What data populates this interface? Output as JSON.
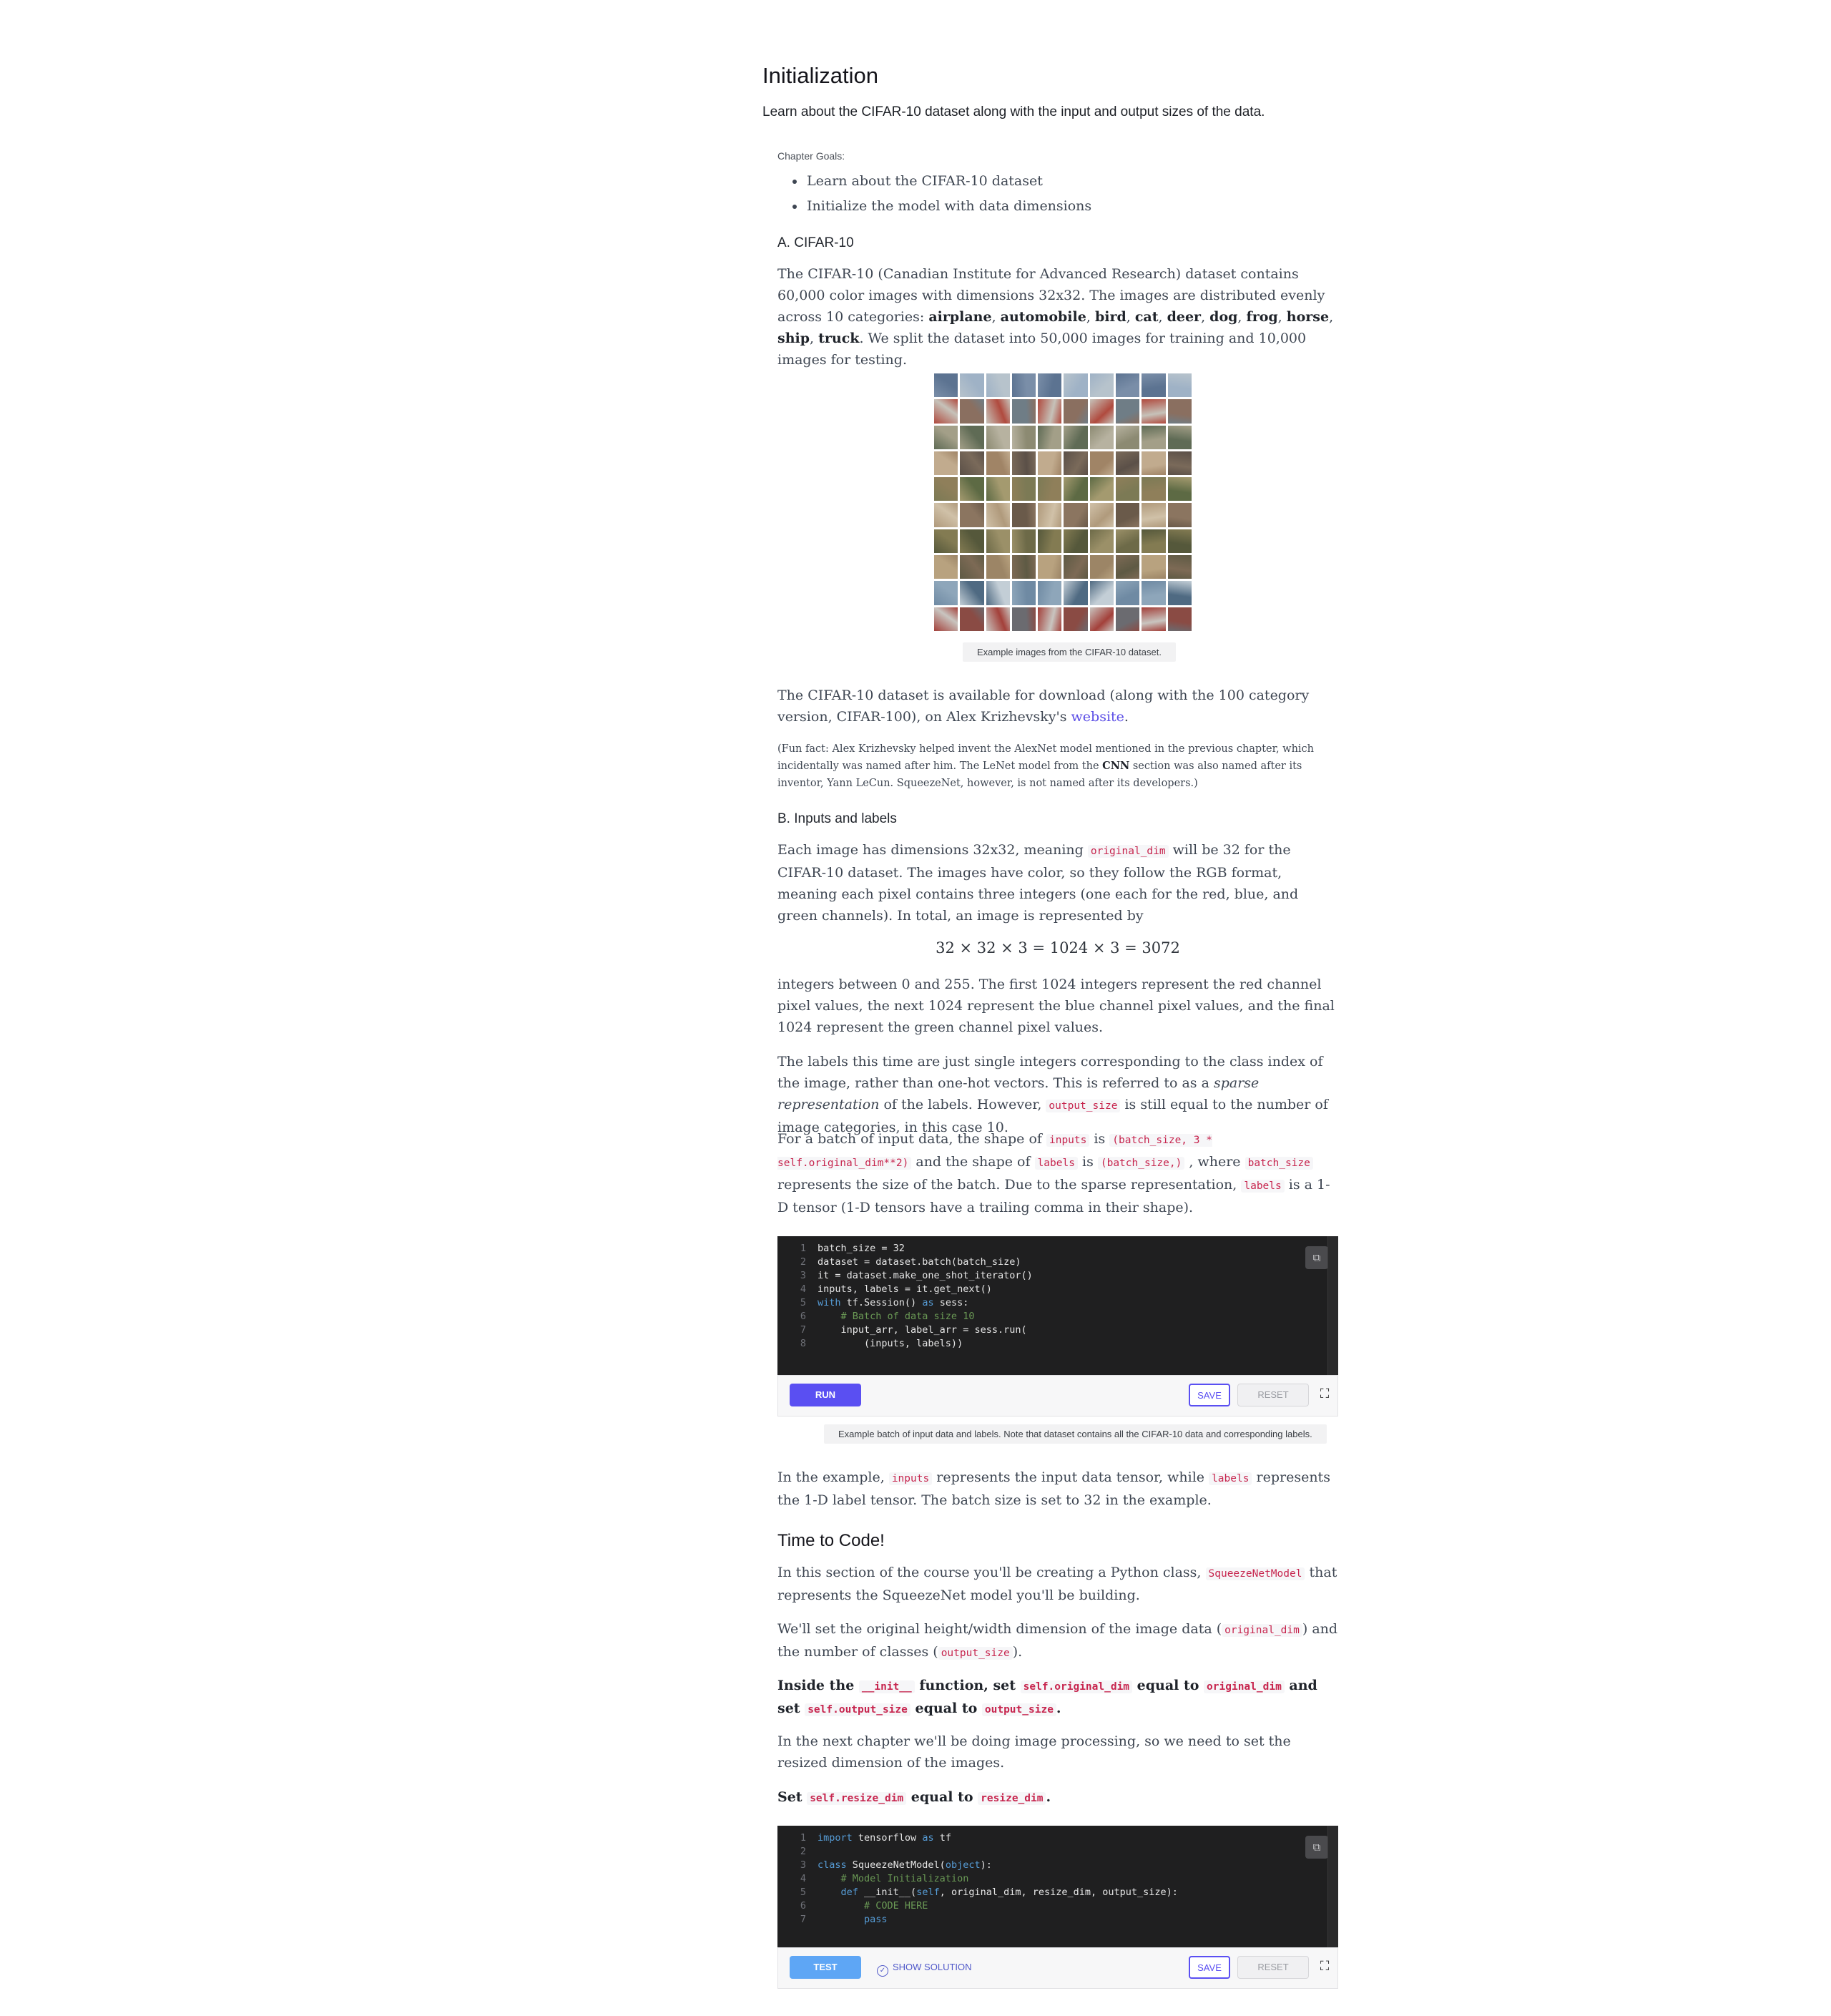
{
  "header": {
    "title": "Initialization",
    "lede": "Learn about the CIFAR-10 dataset along with the input and output sizes of the data."
  },
  "goals": {
    "label": "Chapter Goals:",
    "items": [
      "Learn about the CIFAR-10 dataset",
      "Initialize the model with data dimensions"
    ]
  },
  "sectionA": {
    "heading": "A. CIFAR-10",
    "p1_a": "The CIFAR-10 (Canadian Institute for Advanced Research) dataset contains 60,000 color images with dimensions 32x32. The images are distributed evenly across 10 categories:",
    "categories": [
      "airplane",
      "automobile",
      "bird",
      "cat",
      "deer",
      "dog",
      "frog",
      "horse",
      "ship",
      "truck"
    ],
    "p1_b": ". We split the dataset into 50,000 images for training and 10,000 images for testing.",
    "image_caption": "Example images from the CIFAR-10 dataset.",
    "p2_a": "The CIFAR-10 dataset is available for download (along with the 100 category version, CIFAR-100), on Alex Krizhevsky's ",
    "p2_link": "website",
    "p2_b": ".",
    "fun_a": "(Fun fact: Alex Krizhevsky helped invent the AlexNet model mentioned in the previous chapter, which incidentally was named after him. The LeNet model from the ",
    "fun_bold": "CNN",
    "fun_b": " section was also named after its inventor, Yann LeCun. SqueezeNet, however, is not named after its developers.)"
  },
  "sectionB": {
    "heading": "B. Inputs and labels",
    "p1_a": "Each image has dimensions 32x32, meaning ",
    "p1_code": "original_dim",
    "p1_b": " will be 32 for the CIFAR-10 dataset. The images have color, so they follow the RGB format, meaning each pixel contains three integers (one each for the red, blue, and green channels). In total, an image is represented by",
    "math": "32 × 32 × 3 = 1024 × 3 = 3072",
    "p2": "integers between 0 and 255. The first 1024 integers represent the red channel pixel values, the next 1024 represent the blue channel pixel values, and the final 1024 represent the green channel pixel values.",
    "p3_a": "The labels this time are just single integers corresponding to the class index of the image, rather than one-hot vectors. This is referred to as a ",
    "p3_em": "sparse representation",
    "p3_b": " of the labels. However, ",
    "p3_code": "output_size",
    "p3_c": " is still equal to the number of image categories, in this case 10.",
    "p4_a": "For a batch of input data, the shape of ",
    "p4_code1": "inputs",
    "p4_b": " is ",
    "p4_code2": "(batch_size, 3 * self.original_dim**2)",
    "p4_c": " and the shape of ",
    "p4_code3": "labels",
    "p4_d": " is ",
    "p4_code4": "(batch_size,)",
    "p4_e": " , where ",
    "p4_code5": "batch_size",
    "p4_f": " represents the size of the batch. Due to the sparse representation, ",
    "p4_code6": "labels",
    "p4_g": " is a 1-D tensor (1-D tensors have a trailing comma in their shape).",
    "code1_caption": "Example batch of input data and labels. Note that dataset contains all the CIFAR-10 data and corresponding labels.",
    "p5_a": "In the example, ",
    "p5_code1": "inputs",
    "p5_b": " represents the input data tensor, while ",
    "p5_code2": "labels",
    "p5_c": " represents the 1-D label tensor. The batch size is set to 32 in the example."
  },
  "code1": {
    "lines": [
      "batch_size = 32",
      "dataset = dataset.batch(batch_size)",
      "it = dataset.make_one_shot_iterator()",
      "inputs, labels = it.get_next()",
      "with tf.Session() as sess:",
      "    # Batch of data size 10",
      "    input_arr, label_arr = sess.run(",
      "        (inputs, labels))"
    ],
    "run_label": "RUN",
    "save_label": "SAVE",
    "reset_label": "RESET"
  },
  "timeToCode": {
    "heading": "Time to Code!",
    "p1_a": "In this section of the course you'll be creating a Python class, ",
    "p1_code": "SqueezeNetModel",
    "p1_b": " that represents the SqueezeNet model you'll be building.",
    "p2_a": "We'll set the original height/width dimension of the image data (",
    "p2_code1": "original_dim",
    "p2_b": ") and the number of classes (",
    "p2_code2": "output_size",
    "p2_c": ").",
    "t1_a": "Inside the ",
    "t1_code1": "__init__",
    "t1_b": " function, set ",
    "t1_code2": "self.original_dim",
    "t1_c": " equal to ",
    "t1_code3": "original_dim",
    "t1_d": " and set ",
    "t1_code4": "self.output_size",
    "t1_e": " equal to ",
    "t1_code5": "output_size",
    "t1_f": ".",
    "p3": "In the next chapter we'll be doing image processing, so we need to set the resized dimension of the images.",
    "t2_a": "Set ",
    "t2_code1": "self.resize_dim",
    "t2_b": " equal to ",
    "t2_code2": "resize_dim",
    "t2_c": "."
  },
  "code2": {
    "lines": [
      "import tensorflow as tf",
      "",
      "class SqueezeNetModel(object):",
      "    # Model Initialization",
      "    def __init__(self, original_dim, resize_dim, output_size):",
      "        # CODE HERE",
      "        pass"
    ],
    "test_label": "TEST",
    "solution_label": "SHOW SOLUTION",
    "save_label": "SAVE",
    "reset_label": "RESET"
  },
  "icons": {
    "copy": "copy-icon",
    "fullscreen": "fullscreen-icon",
    "check": "check-circle-icon"
  }
}
